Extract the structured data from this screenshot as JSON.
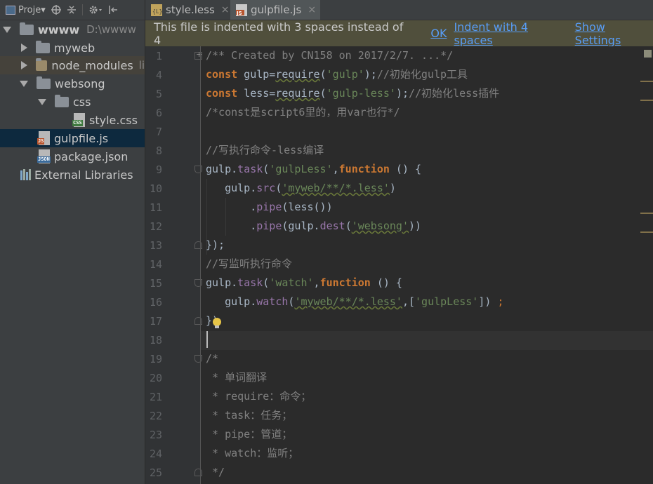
{
  "project_panel": {
    "toolbar_label": "Proje▾",
    "items": [
      {
        "label": "wwww",
        "path": "D:\\wwww"
      },
      {
        "label": "myweb"
      },
      {
        "label": "node_modules",
        "extra": "li"
      },
      {
        "label": "websong"
      },
      {
        "label": "css"
      },
      {
        "label": "style.css",
        "icon_tag": "CSS"
      },
      {
        "label": "gulpfile.js",
        "icon_tag": "JS"
      },
      {
        "label": "package.json",
        "icon_tag": "JSON"
      },
      {
        "label": "External Libraries"
      }
    ]
  },
  "tabs": [
    {
      "label": "style.less",
      "icon": "less-file-icon",
      "close": "×"
    },
    {
      "label": "gulpfile.js",
      "icon": "js-file-icon",
      "close": "×"
    }
  ],
  "banner": {
    "message": "This file is indented with 3 spaces instead of 4",
    "ok": "OK",
    "indent": "Indent with 4 spaces",
    "settings": "Show Settings"
  },
  "editor": {
    "line_numbers": [
      "1",
      "4",
      "5",
      "6",
      "7",
      "8",
      "9",
      "10",
      "11",
      "12",
      "13",
      "14",
      "15",
      "16",
      "17",
      "18",
      "19",
      "20",
      "21",
      "22",
      "23",
      "24",
      "25"
    ],
    "code": {
      "l1": "/** Created by CN158 on 2017/2/7. ...*/",
      "l4_kw": "const",
      "l4_a": " gulp=",
      "l4_req": "require",
      "l4_b": "(",
      "l4_str": "'gulp'",
      "l4_c": ");",
      "l4_cm": "//初始化gulp工具",
      "l5_kw": "const",
      "l5_a": " less=",
      "l5_req": "require",
      "l5_b": "(",
      "l5_str": "'gulp-less'",
      "l5_c": ");",
      "l5_cm": "//初始化less插件",
      "l6": "/*const是script6里的，用var也行*/",
      "l8": "//写执行命令-less编译",
      "l9_a": "gulp.",
      "l9_fn": "task",
      "l9_b": "(",
      "l9_str": "'gulpLess'",
      "l9_c": ",",
      "l9_kw": "function",
      "l9_d": " () {",
      "l10_a": "   gulp.",
      "l10_fn": "src",
      "l10_b": "(",
      "l10_str": "'myweb/**/*.less'",
      "l10_c": ")",
      "l11_a": "       .",
      "l11_fn": "pipe",
      "l11_b": "(less())",
      "l12_a": "       .",
      "l12_fn": "pipe",
      "l12_b": "(gulp.",
      "l12_fn2": "dest",
      "l12_c": "(",
      "l12_str": "'websong'",
      "l12_d": "))",
      "l13": "});",
      "l14": "//写监听执行命令",
      "l15_a": "gulp.",
      "l15_fn": "task",
      "l15_b": "(",
      "l15_str": "'watch'",
      "l15_c": ",",
      "l15_kw": "function",
      "l15_d": " () {",
      "l16_a": "   gulp.",
      "l16_fn": "watch",
      "l16_b": "(",
      "l16_str": "'myweb/**/*.less'",
      "l16_c": ",[",
      "l16_str2": "'gulpLess'",
      "l16_d": "]) ",
      "l16_e": ";",
      "l17": "})",
      "l19": "/*",
      "l20": " * 单词翻译",
      "l21": " * require：命令；",
      "l22": " * task：任务；",
      "l23": " * pipe：管道；",
      "l24": " * watch：监听；",
      "l25": " */"
    }
  },
  "colors": {
    "keyword": "#cc7832",
    "string": "#6a8759",
    "comment": "#808080",
    "function": "#9876aa",
    "link": "#589df6",
    "banner_bg": "#504f3c"
  }
}
